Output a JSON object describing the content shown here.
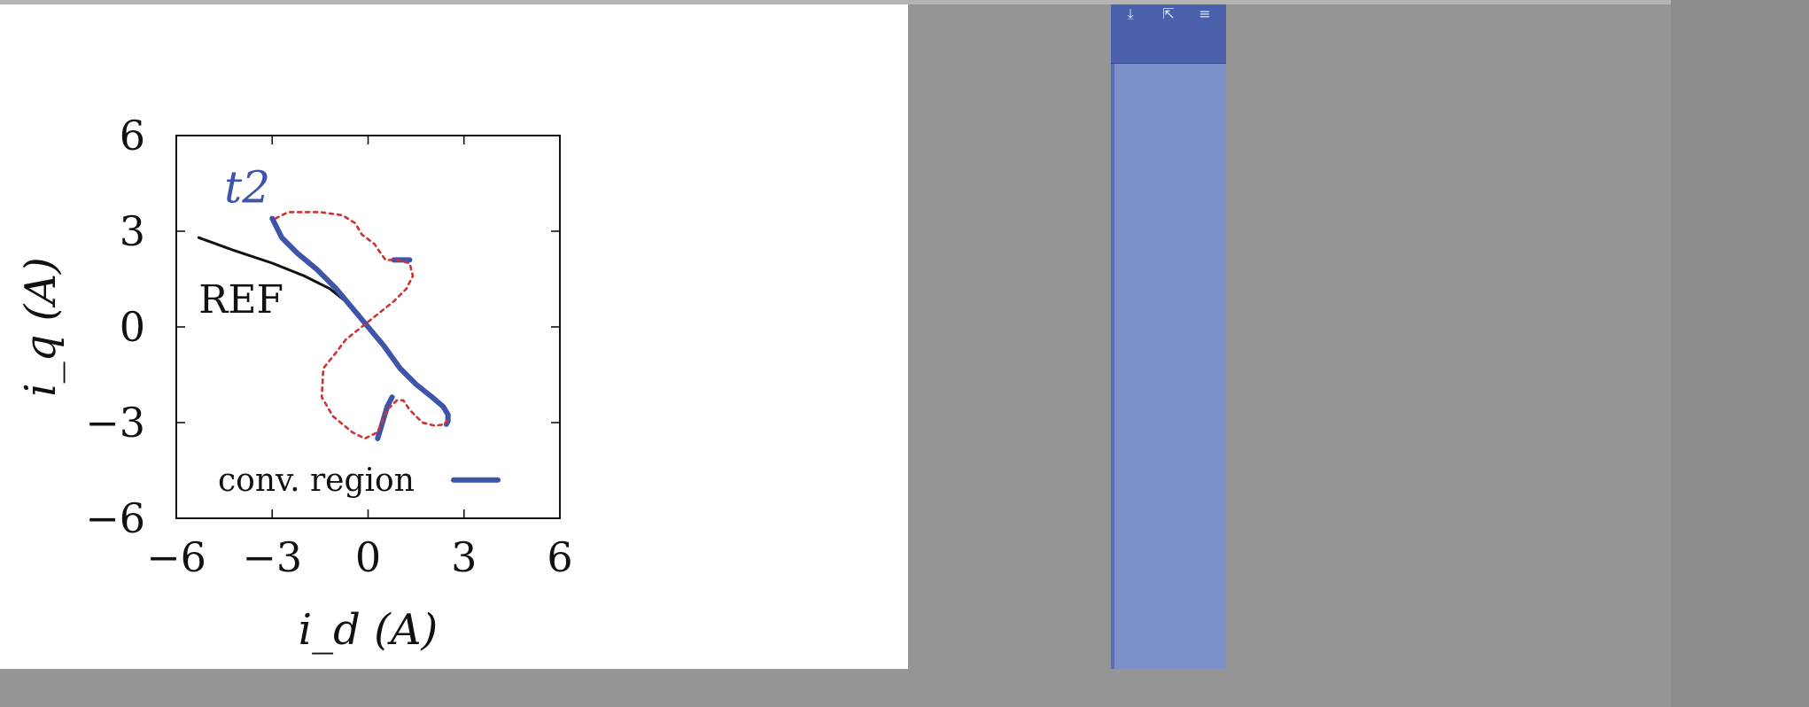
{
  "chart_data": {
    "type": "line",
    "xlabel": "i_d (A)",
    "ylabel": "i_q (A)",
    "xlim": [
      -6,
      6
    ],
    "ylim": [
      -6,
      6
    ],
    "xticks": [
      "−6",
      "−3",
      "0",
      "3",
      "6"
    ],
    "yticks": [
      "6",
      "3",
      "0",
      "−3",
      "−6"
    ],
    "grid": false,
    "annotations": [
      "t2",
      "REF"
    ],
    "legend": {
      "label": "conv. region",
      "placement": "bottom"
    },
    "series": [
      {
        "name": "REF",
        "color": "#111111",
        "style": "solid",
        "x": [
          -5.3,
          -4.2,
          -3.0,
          -2.0,
          -1.2,
          -0.7,
          -0.3,
          0.0
        ],
        "y": [
          2.8,
          2.4,
          2.0,
          1.6,
          1.2,
          0.8,
          0.4,
          0.0
        ]
      },
      {
        "name": "conv. region",
        "color": "#3d54a8",
        "style": "solid",
        "segments": [
          {
            "x": [
              -3.0,
              -2.7,
              -2.2,
              -1.6,
              -1.0,
              -0.5,
              0.0,
              0.5,
              1.0,
              1.5,
              2.0,
              2.35,
              2.5,
              2.5,
              2.45
            ],
            "y": [
              3.4,
              2.8,
              2.3,
              1.8,
              1.2,
              0.6,
              0.0,
              -0.6,
              -1.3,
              -1.8,
              -2.2,
              -2.5,
              -2.75,
              -2.95,
              -3.05
            ]
          },
          {
            "x": [
              0.3,
              0.45,
              0.6,
              0.75
            ],
            "y": [
              -3.5,
              -3.0,
              -2.5,
              -2.2
            ]
          },
          {
            "x": [
              0.8,
              1.3
            ],
            "y": [
              2.1,
              2.1
            ]
          }
        ]
      },
      {
        "name": "",
        "color": "#cc3333",
        "style": "dashed",
        "x": [
          -2.9,
          -2.5,
          -1.5,
          -0.8,
          -0.4,
          -0.2,
          0.2,
          0.4,
          0.55,
          0.9,
          1.3,
          1.4,
          1.2,
          0.8,
          0.3,
          -0.2,
          -0.7,
          -1.0,
          -1.4,
          -1.45,
          -1.1,
          -0.5,
          -0.1,
          0.3,
          0.6,
          0.9,
          1.1,
          1.3,
          1.7,
          2.1,
          2.4,
          2.5
        ],
        "y": [
          3.4,
          3.6,
          3.6,
          3.5,
          3.25,
          2.9,
          2.6,
          2.3,
          2.1,
          2.1,
          2.0,
          1.6,
          1.2,
          0.8,
          0.4,
          0.0,
          -0.4,
          -0.8,
          -1.3,
          -2.2,
          -2.8,
          -3.3,
          -3.5,
          -3.3,
          -2.6,
          -2.3,
          -2.3,
          -2.6,
          -3.0,
          -3.1,
          -3.05,
          -2.9
        ]
      }
    ]
  },
  "ui": {
    "toolbar_icons": [
      "download-icon",
      "share-icon",
      "menu-icon"
    ],
    "toolbar_glyphs": [
      "⤓",
      "⇱",
      "≡"
    ]
  }
}
